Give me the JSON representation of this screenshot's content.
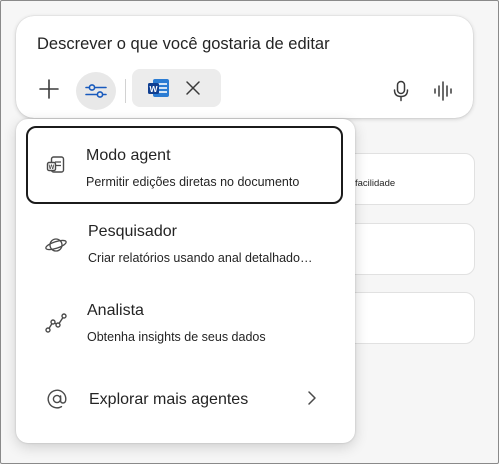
{
  "composer": {
    "prompt_text": "Descrever o que você gostaria de editar",
    "icons": [
      "plus-icon",
      "sliders-icon",
      "word-doc-icon",
      "close-icon",
      "microphone-icon",
      "voice-waveform-icon"
    ]
  },
  "background_cards": [
    {
      "text": "facilidade"
    },
    {
      "text": ""
    },
    {
      "text": ""
    }
  ],
  "menu": {
    "items": [
      {
        "title": "Modo agent",
        "subtitle": "Permitir edições diretas no documento",
        "icon": "word-agent-icon",
        "selected": true
      },
      {
        "title": "Pesquisador",
        "subtitle": "Criar relatórios usando anal detalhado…",
        "icon": "planet-icon"
      },
      {
        "title": "Analista",
        "subtitle": "Obtenha insights de seus dados",
        "icon": "chart-line-icon"
      },
      {
        "title": "Explorar mais agentes",
        "icon": "at-sign-icon",
        "trailing_icon": "chevron-right-icon"
      }
    ]
  },
  "colors": {
    "accent_word_blue": "#185ABD",
    "word_dark": "#103F91",
    "text": "#242424",
    "selected_border": "#1b1b1b"
  }
}
